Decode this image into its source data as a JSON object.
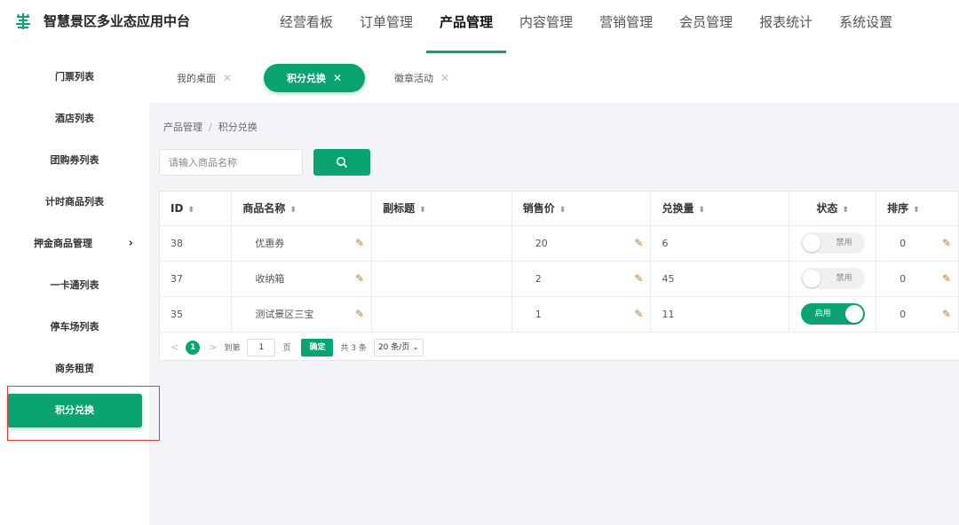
{
  "app": {
    "title": "智慧景区多业态应用中台",
    "logo_icon": "scenic-logo-icon",
    "accent_color": "#0aa472"
  },
  "nav": {
    "items": [
      {
        "label": "经营看板"
      },
      {
        "label": "订单管理"
      },
      {
        "label": "产品管理",
        "active": true
      },
      {
        "label": "内容管理"
      },
      {
        "label": "营销管理"
      },
      {
        "label": "会员管理"
      },
      {
        "label": "报表统计"
      },
      {
        "label": "系统设置"
      }
    ]
  },
  "sidebar": {
    "items": [
      {
        "label": "门票列表"
      },
      {
        "label": "酒店列表"
      },
      {
        "label": "团购券列表"
      },
      {
        "label": "计时商品列表"
      },
      {
        "label": "押金商品管理",
        "chevron": "chevron-right-icon"
      },
      {
        "label": "一卡通列表"
      },
      {
        "label": "停车场列表"
      },
      {
        "label": "商务租赁"
      },
      {
        "label": "积分兑换",
        "active": true
      }
    ]
  },
  "tabs": [
    {
      "label": "我的桌面"
    },
    {
      "label": "积分兑换",
      "active": true
    },
    {
      "label": "徽章活动"
    }
  ],
  "breadcrumb": {
    "parent": "产品管理",
    "separator": "/",
    "current": "积分兑换"
  },
  "search": {
    "placeholder": "请输入商品名称",
    "button_icon": "search-icon"
  },
  "table": {
    "columns": [
      "ID",
      "商品名称",
      "副标题",
      "销售价",
      "兑换量",
      "状态",
      "排序"
    ],
    "rows": [
      {
        "id": "38",
        "name": "优惠券",
        "subtitle": "",
        "price": "20",
        "exchanged": "6",
        "status_label": "禁用",
        "status_on": false,
        "sort": "0"
      },
      {
        "id": "37",
        "name": "收纳箱",
        "subtitle": "",
        "price": "2",
        "exchanged": "45",
        "status_label": "禁用",
        "status_on": false,
        "sort": "0"
      },
      {
        "id": "35",
        "name": "测试景区三宝",
        "subtitle": "",
        "price": "1",
        "exchanged": "11",
        "status_label": "启用",
        "status_on": true,
        "sort": "0"
      }
    ]
  },
  "pagination": {
    "current_page": "1",
    "goto_label": "到第",
    "goto_value": "1",
    "page_suffix": "页",
    "confirm_label": "确定",
    "total_label": "共 3 条",
    "page_size": "20 条/页"
  }
}
